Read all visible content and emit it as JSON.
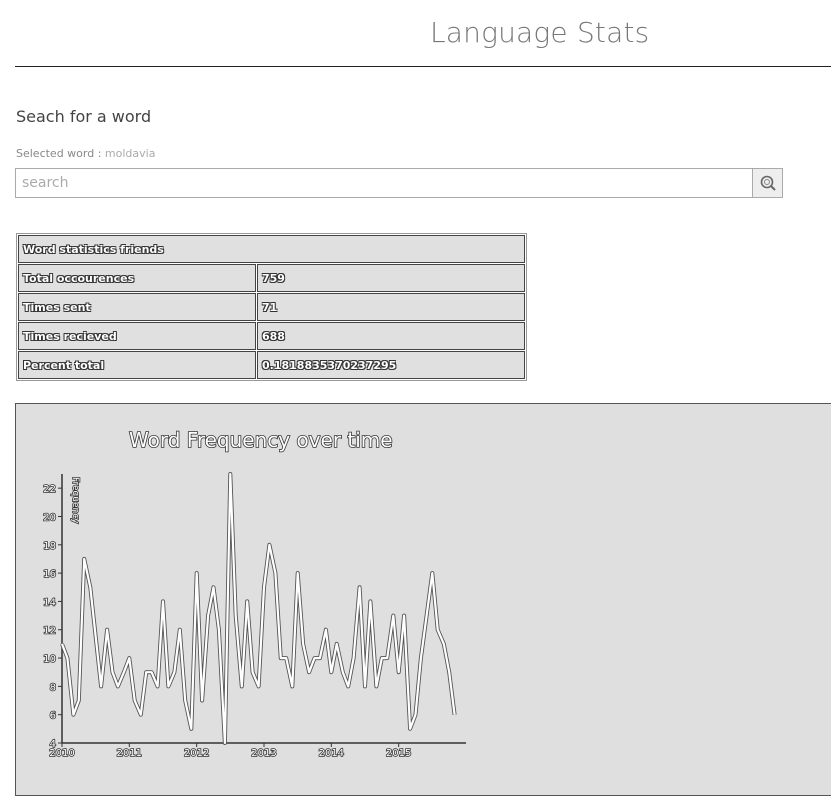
{
  "header": {
    "title": "Language Stats"
  },
  "search": {
    "heading": "Seach for a word",
    "selected_label": "Selected word :",
    "selected_word": "moldavia",
    "placeholder": "search",
    "button_icon": "search-icon"
  },
  "stats_table": {
    "title": "Word statistics friends",
    "rows": [
      {
        "label": "Total occourences",
        "value": "759"
      },
      {
        "label": "Times sent",
        "value": "71"
      },
      {
        "label": "Times recieved",
        "value": "688"
      },
      {
        "label": "Percent total",
        "value": "0.1818835370237295"
      }
    ]
  },
  "chart_data": {
    "type": "line",
    "title": "Word Frequency over time",
    "xlabel": "",
    "ylabel": "Frequency",
    "x_ticks": [
      "2010",
      "2011",
      "2012",
      "2013",
      "2014",
      "2015"
    ],
    "y_ticks": [
      4,
      6,
      8,
      10,
      12,
      14,
      16,
      18,
      20,
      22
    ],
    "xlim": [
      2010.0,
      2016.0
    ],
    "ylim": [
      4,
      23
    ],
    "grid": false,
    "series": [
      {
        "values": [
          [
            2010.0,
            11
          ],
          [
            2010.08,
            10
          ],
          [
            2010.17,
            6
          ],
          [
            2010.25,
            7
          ],
          [
            2010.33,
            17
          ],
          [
            2010.42,
            15
          ],
          [
            2010.58,
            8
          ],
          [
            2010.67,
            12
          ],
          [
            2010.75,
            9
          ],
          [
            2010.83,
            8
          ],
          [
            2010.92,
            9
          ],
          [
            2011.0,
            10
          ],
          [
            2011.08,
            7
          ],
          [
            2011.17,
            6
          ],
          [
            2011.25,
            9
          ],
          [
            2011.33,
            9
          ],
          [
            2011.42,
            8
          ],
          [
            2011.5,
            14
          ],
          [
            2011.58,
            8
          ],
          [
            2011.67,
            9
          ],
          [
            2011.75,
            12
          ],
          [
            2011.83,
            7
          ],
          [
            2011.92,
            5
          ],
          [
            2012.0,
            16
          ],
          [
            2012.08,
            7
          ],
          [
            2012.17,
            13
          ],
          [
            2012.25,
            15
          ],
          [
            2012.33,
            12
          ],
          [
            2012.42,
            4
          ],
          [
            2012.5,
            23
          ],
          [
            2012.58,
            13
          ],
          [
            2012.67,
            8
          ],
          [
            2012.75,
            14
          ],
          [
            2012.83,
            9
          ],
          [
            2012.92,
            8
          ],
          [
            2013.0,
            15
          ],
          [
            2013.08,
            18
          ],
          [
            2013.17,
            16
          ],
          [
            2013.25,
            10
          ],
          [
            2013.33,
            10
          ],
          [
            2013.42,
            8
          ],
          [
            2013.5,
            16
          ],
          [
            2013.58,
            11
          ],
          [
            2013.67,
            9
          ],
          [
            2013.75,
            10
          ],
          [
            2013.83,
            10
          ],
          [
            2013.92,
            12
          ],
          [
            2014.0,
            9
          ],
          [
            2014.08,
            11
          ],
          [
            2014.17,
            9
          ],
          [
            2014.25,
            8
          ],
          [
            2014.33,
            10
          ],
          [
            2014.42,
            15
          ],
          [
            2014.5,
            8
          ],
          [
            2014.58,
            14
          ],
          [
            2014.67,
            8
          ],
          [
            2014.75,
            10
          ],
          [
            2014.83,
            10
          ],
          [
            2014.92,
            13
          ],
          [
            2015.0,
            9
          ],
          [
            2015.08,
            13
          ],
          [
            2015.17,
            5
          ],
          [
            2015.25,
            6
          ],
          [
            2015.33,
            10
          ],
          [
            2015.5,
            16
          ],
          [
            2015.58,
            12
          ],
          [
            2015.67,
            11
          ],
          [
            2015.75,
            9
          ],
          [
            2015.83,
            6
          ]
        ]
      }
    ]
  }
}
